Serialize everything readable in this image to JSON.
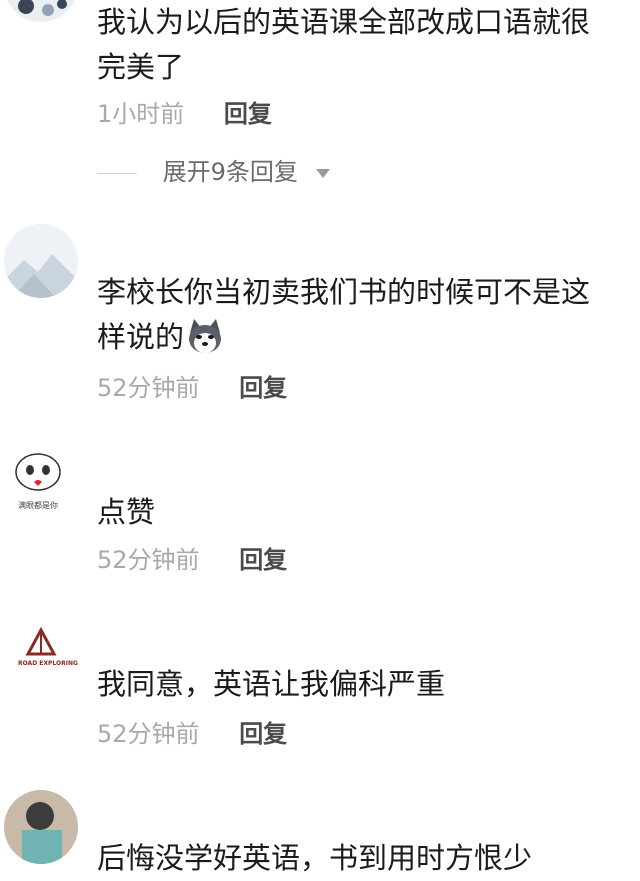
{
  "comments": [
    {
      "text": "我认为以后的英语课全部改成口语就很完美了",
      "time": "1小时前",
      "reply_label": "回复",
      "expand_label": "展开9条回复"
    },
    {
      "username": "",
      "text": "李校长你当初卖我们书的时候可不是这样说的",
      "time": "52分钟前",
      "reply_label": "回复"
    },
    {
      "username": "",
      "avatar_caption": "满眼都是你",
      "text": "点赞",
      "time": "52分钟前",
      "reply_label": "回复"
    },
    {
      "username": "",
      "avatar_caption": "ROAD EXPLORING",
      "text": "我同意，英语让我偏科严重",
      "time": "52分钟前",
      "reply_label": "回复"
    },
    {
      "username": "",
      "text": "后悔没学好英语，书到用时方恨少"
    }
  ],
  "icons": {
    "emoji": "husky-dog-emoji",
    "expand_caret": "caret-down-icon"
  }
}
